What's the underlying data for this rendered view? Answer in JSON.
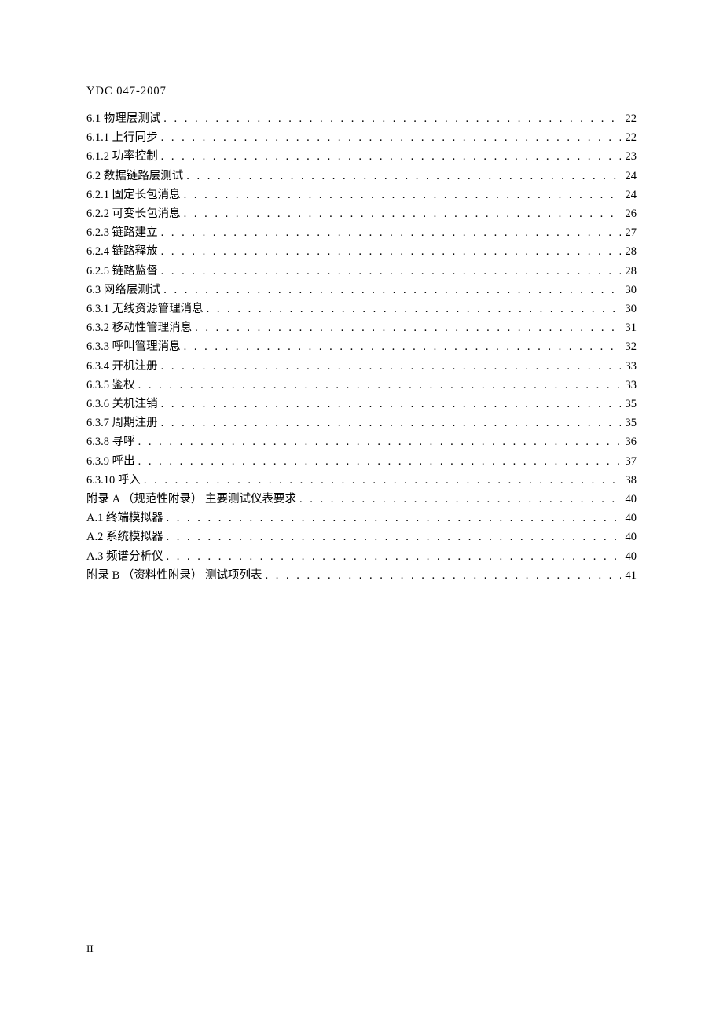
{
  "doc_header": "YDC 047-2007",
  "page_number_roman": "II",
  "toc": [
    {
      "label": "6.1 物理层测试",
      "page": "22"
    },
    {
      "label": "6.1.1 上行同步",
      "page": "22"
    },
    {
      "label": "6.1.2 功率控制",
      "page": "23"
    },
    {
      "label": "6.2 数据链路层测试",
      "page": "24"
    },
    {
      "label": "6.2.1 固定长包消息",
      "page": "24"
    },
    {
      "label": "6.2.2 可变长包消息",
      "page": "26"
    },
    {
      "label": "6.2.3 链路建立",
      "page": "27"
    },
    {
      "label": "6.2.4 链路释放",
      "page": "28"
    },
    {
      "label": "6.2.5 链路监督",
      "page": "28"
    },
    {
      "label": "6.3 网络层测试",
      "page": "30"
    },
    {
      "label": "6.3.1 无线资源管理消息",
      "page": "30"
    },
    {
      "label": "6.3.2 移动性管理消息",
      "page": "31"
    },
    {
      "label": "6.3.3 呼叫管理消息",
      "page": "32"
    },
    {
      "label": "6.3.4 开机注册",
      "page": "33"
    },
    {
      "label": "6.3.5 鉴权",
      "page": "33"
    },
    {
      "label": "6.3.6 关机注销",
      "page": "35"
    },
    {
      "label": "6.3.7 周期注册",
      "page": "35"
    },
    {
      "label": "6.3.8 寻呼",
      "page": "36"
    },
    {
      "label": "6.3.9 呼出",
      "page": "37"
    },
    {
      "label": "6.3.10 呼入",
      "page": "38"
    },
    {
      "label": "附录 A （规范性附录） 主要测试仪表要求",
      "page": "40"
    },
    {
      "label": "A.1 终端模拟器",
      "page": "40"
    },
    {
      "label": "A.2 系统模拟器",
      "page": "40"
    },
    {
      "label": "A.3 频谱分析仪",
      "page": "40"
    },
    {
      "label": "附录 B （资料性附录） 测试项列表",
      "page": "41"
    }
  ]
}
